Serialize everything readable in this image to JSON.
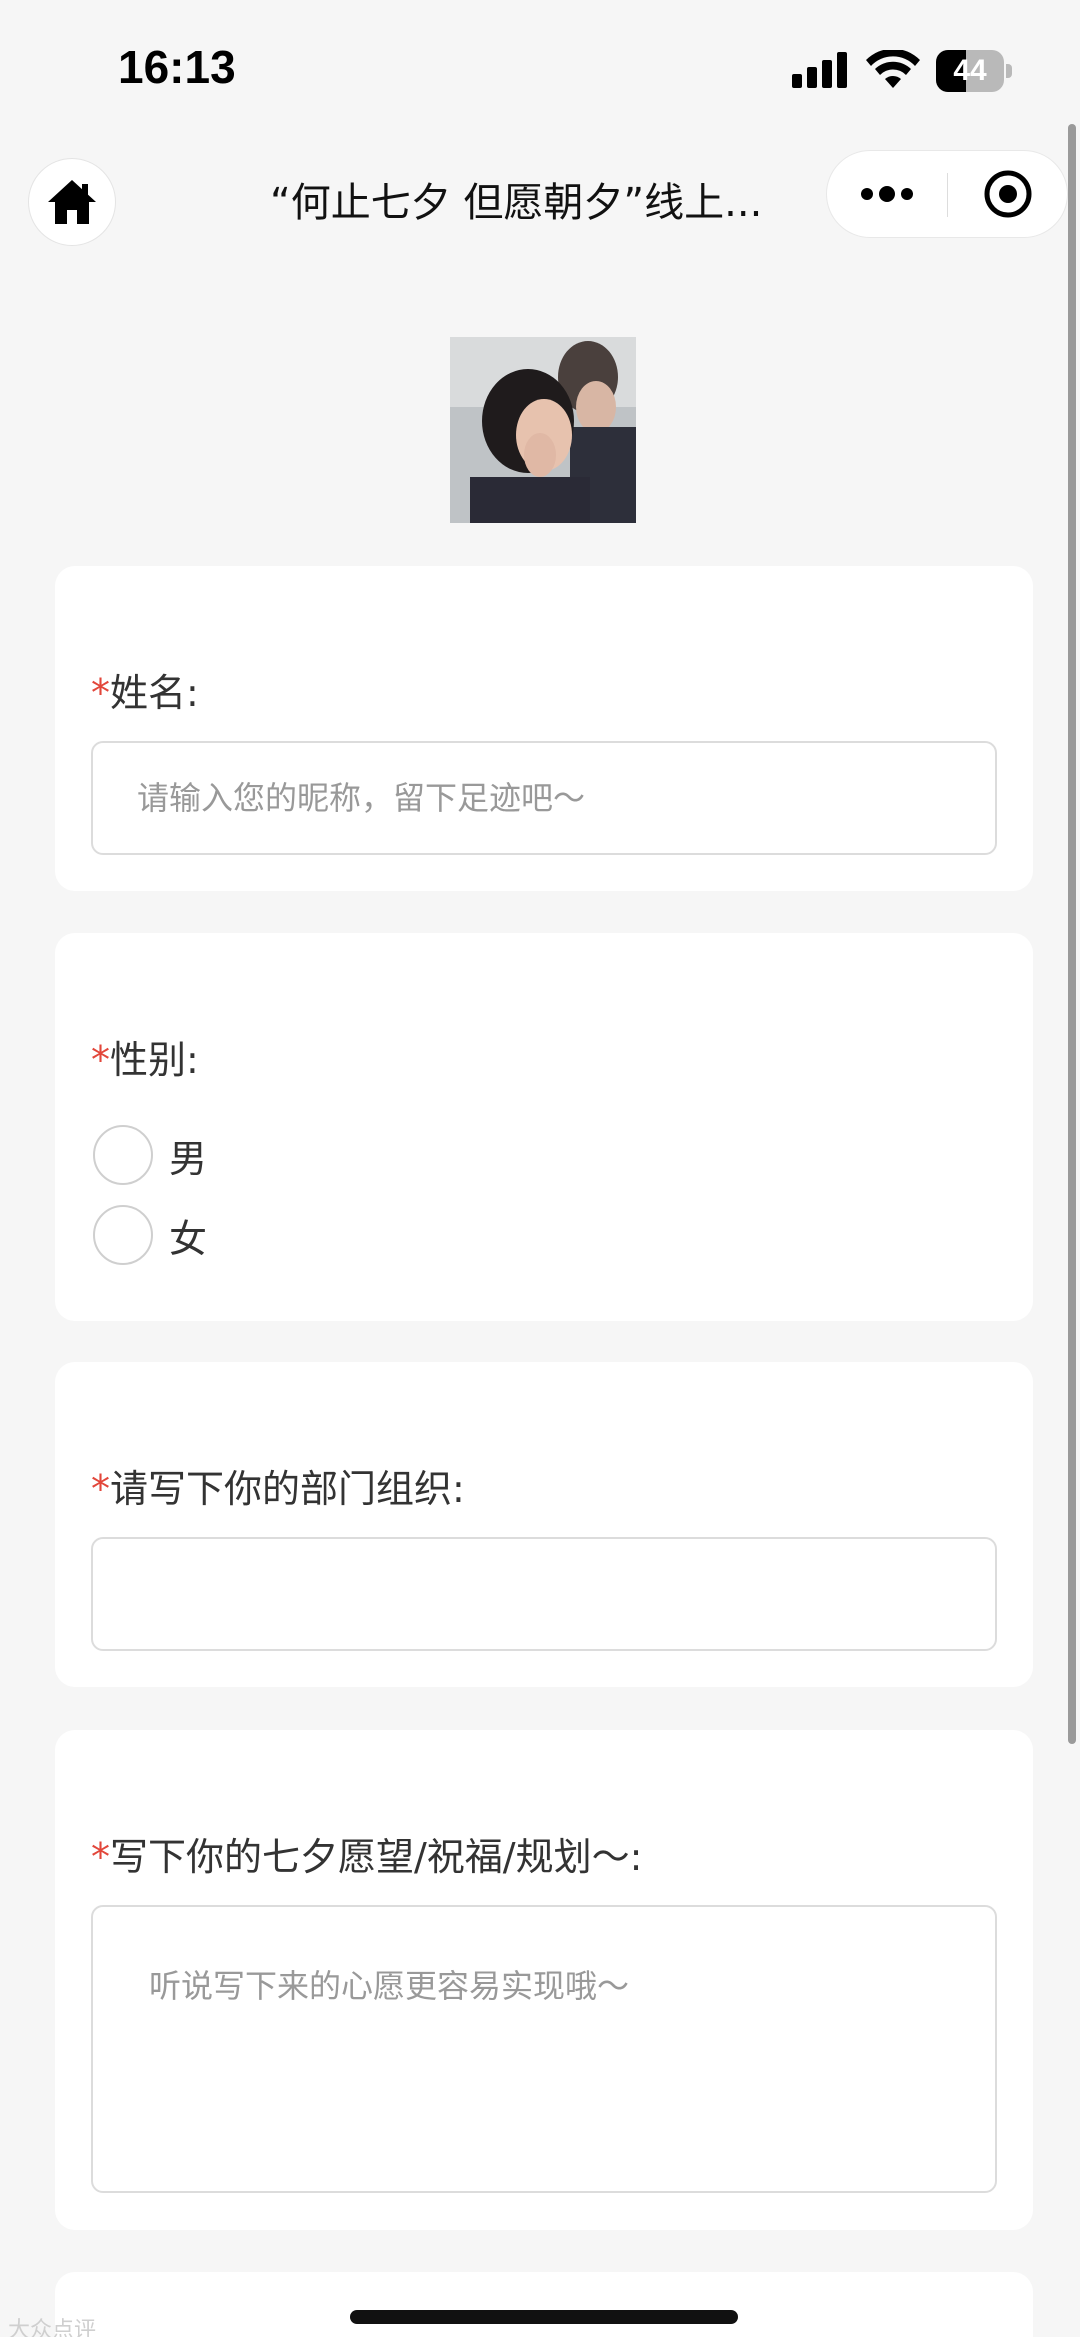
{
  "status_bar": {
    "time": "16:13",
    "battery_level": "44",
    "battery_percent": 44,
    "icons": [
      "signal-icon",
      "wifi-icon",
      "battery-icon"
    ]
  },
  "nav": {
    "title": "“何止七夕 但愿朝夕”线上...",
    "home_icon": "home-icon",
    "more_icon": "more-dots-icon",
    "close_icon": "target-close-icon"
  },
  "cover_image": {
    "description_icon": "couple-photo"
  },
  "form": {
    "required_mark": "*",
    "name": {
      "label": "姓名:",
      "placeholder": "请输入您的昵称，留下足迹吧～"
    },
    "gender": {
      "label": "性别:",
      "options": [
        "男",
        "女"
      ]
    },
    "department": {
      "label": "请写下你的部门组织:",
      "value": ""
    },
    "wish": {
      "label": "写下你的七夕愿望/祝福/规划～:",
      "placeholder": "听说写下来的心愿更容易实现哦～"
    }
  },
  "watermark": "大众点评",
  "colors": {
    "required": "#e2463a",
    "background": "#f6f6f6",
    "card": "#ffffff"
  }
}
